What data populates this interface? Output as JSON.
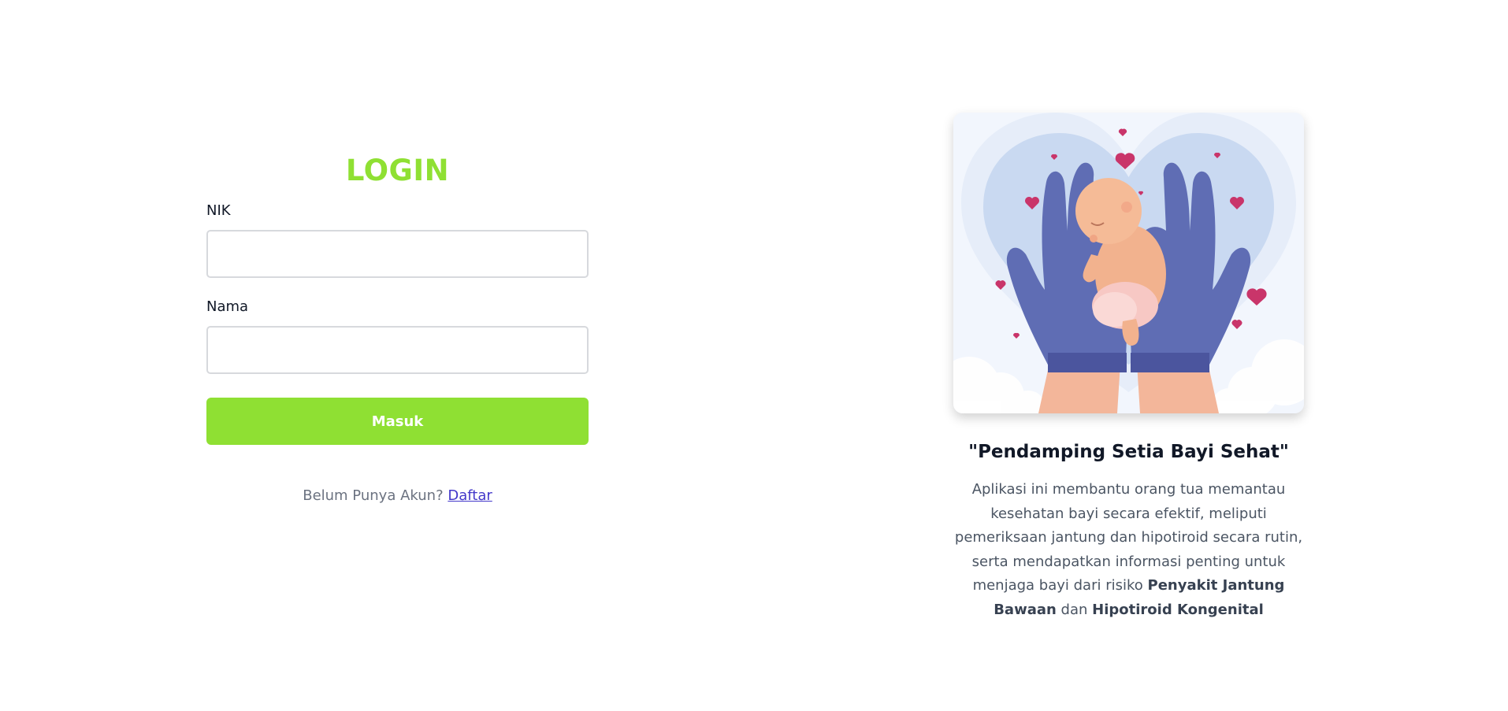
{
  "login": {
    "title": "LOGIN",
    "nik_label": "NIK",
    "nik_value": "",
    "nama_label": "Nama",
    "nama_value": "",
    "submit_label": "Masuk",
    "register_prompt": "Belum Punya Akun?",
    "register_link": "Daftar"
  },
  "info": {
    "tagline": "\"Pendamping Setia Bayi Sehat\"",
    "description_lead": "Aplikasi ini membantu orang tua memantau kesehatan bayi secara efektif, meliputi pemeriksaan jantung dan hipotiroid secara rutin, serta mendapatkan informasi penting untuk menjaga bayi dari risiko",
    "highlight_1": "Penyakit Jantung Bawaan",
    "conjunction": "dan",
    "highlight_2": "Hipotiroid Kongenital",
    "illustration_icon": "hands-holding-baby-illustration"
  },
  "colors": {
    "accent_green": "#8fe033",
    "link_blue": "#4338ca",
    "glove_blue": "#5f6db4",
    "heart_pink": "#c9356a"
  }
}
